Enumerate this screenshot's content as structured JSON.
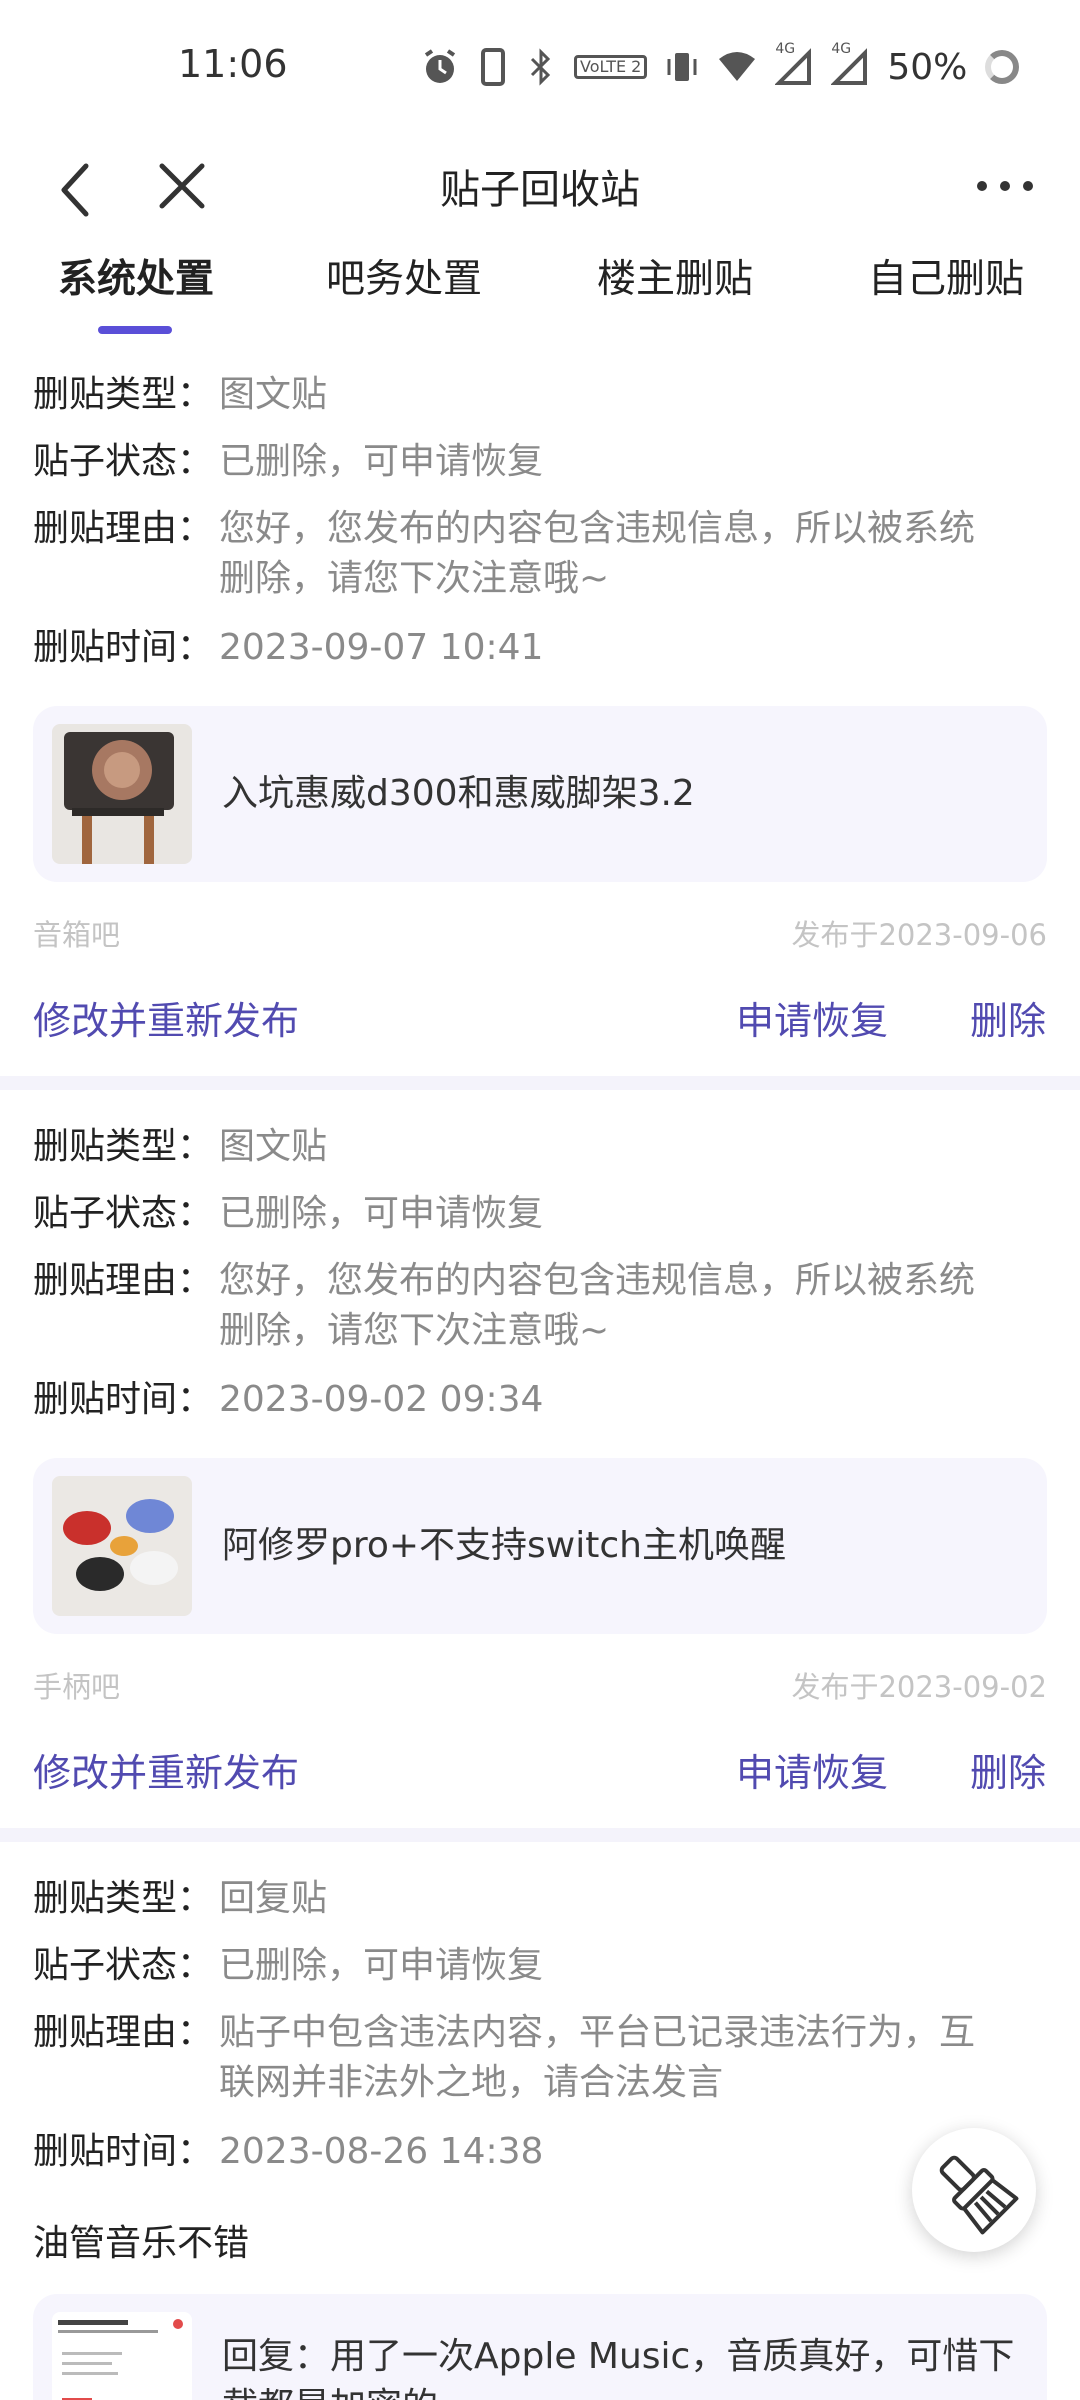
{
  "status_bar": {
    "time": "11:06",
    "battery": "50%",
    "net1": "4G",
    "net2": "4G",
    "volte": "VoLTE 2"
  },
  "nav": {
    "title": "贴子回收站"
  },
  "tabs": [
    {
      "label": "系统处置",
      "active": true
    },
    {
      "label": "吧务处置",
      "active": false
    },
    {
      "label": "楼主删贴",
      "active": false
    },
    {
      "label": "自己删贴",
      "active": false
    }
  ],
  "labels": {
    "type": "删贴类型：",
    "status": "贴子状态：",
    "reason": "删贴理由：",
    "time": "删贴时间："
  },
  "posts": [
    {
      "type": "图文贴",
      "status": "已删除，可申请恢复",
      "reason": "您好，您发布的内容包含违规信息，所以被系统删除，请您下次注意哦~",
      "time": "2023-09-07 10:41",
      "title": "入坑惠威d300和惠威脚架3.2",
      "forum": "音箱吧",
      "published": "发布于2023-09-06",
      "actions": {
        "edit": "修改并重新发布",
        "restore": "申请恢复",
        "delete": "删除"
      }
    },
    {
      "type": "图文贴",
      "status": "已删除，可申请恢复",
      "reason": "您好，您发布的内容包含违规信息，所以被系统删除，请您下次注意哦~",
      "time": "2023-09-02 09:34",
      "title": "阿修罗pro+不支持switch主机唤醒",
      "forum": "手柄吧",
      "published": "发布于2023-09-02",
      "actions": {
        "edit": "修改并重新发布",
        "restore": "申请恢复",
        "delete": "删除"
      }
    },
    {
      "type": "回复贴",
      "status": "已删除，可申请恢复",
      "reason": "贴子中包含违法内容，平台已记录违法行为，互联网并非法外之地，请合法发言",
      "time": "2023-08-26 14:38",
      "comment": "油管音乐不错",
      "title": "回复：用了一次Apple Music，音质真好，可惜下载都是加密的"
    }
  ],
  "colors": {
    "accent": "#514ab0",
    "indicator": "#5a4fd8",
    "post_bg": "#f6f5fd"
  }
}
